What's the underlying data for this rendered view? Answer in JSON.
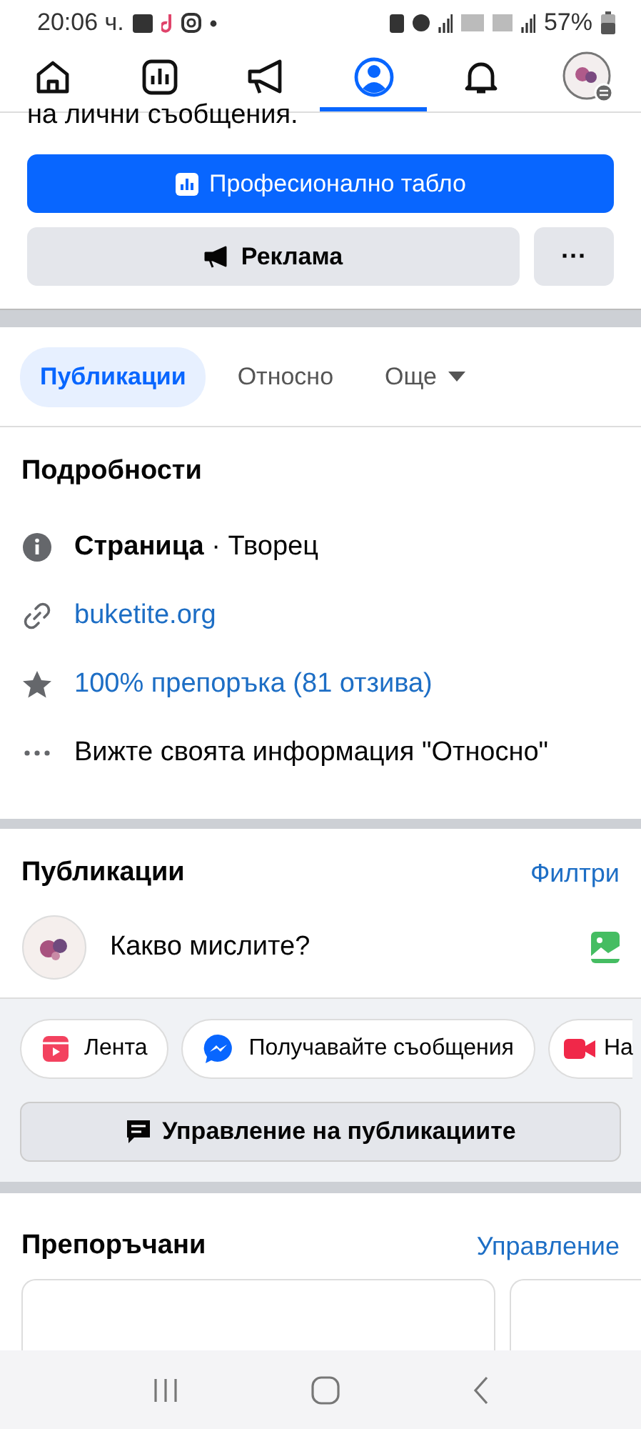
{
  "status_bar": {
    "time": "20:06 ч.",
    "battery": "57%"
  },
  "nav": [
    {
      "kind": "home",
      "selected": false
    },
    {
      "kind": "dashboard",
      "selected": false
    },
    {
      "kind": "ads",
      "selected": false
    },
    {
      "kind": "profile",
      "selected": true
    },
    {
      "kind": "bell",
      "selected": false
    },
    {
      "kind": "avatar",
      "selected": false
    }
  ],
  "cut_text": "на лични съобщения.",
  "professional_button": "Професионално табло",
  "ads_button": "Реклама",
  "more_button": "···",
  "tabs": [
    {
      "label": "Публикации",
      "selected": true,
      "kind": "tab"
    },
    {
      "label": "Относно",
      "selected": false,
      "kind": "tab"
    },
    {
      "label": "Още",
      "selected": false,
      "kind": "dropdown"
    }
  ],
  "details": {
    "title": "Подробности",
    "rows": [
      {
        "kind": "info",
        "text": "**Страница** · Творец"
      },
      {
        "kind": "link",
        "text": "buketite.org"
      },
      {
        "kind": "rating",
        "text": "100% препоръка (81 отзива)"
      },
      {
        "kind": "more",
        "text": "Вижте своята информация \"Относно\""
      }
    ]
  },
  "posts": {
    "title": "Публикации",
    "filters": "Филтри",
    "composer_placeholder": "Какво мислите?",
    "chips": [
      {
        "kind": "reel",
        "label": "Лента"
      },
      {
        "kind": "messenger",
        "label": "Получавайте съобщения"
      },
      {
        "kind": "live",
        "label": "На"
      }
    ],
    "manage_button": "Управление на публикациите"
  },
  "recommended": {
    "title": "Препоръчани",
    "manage": "Управление"
  }
}
